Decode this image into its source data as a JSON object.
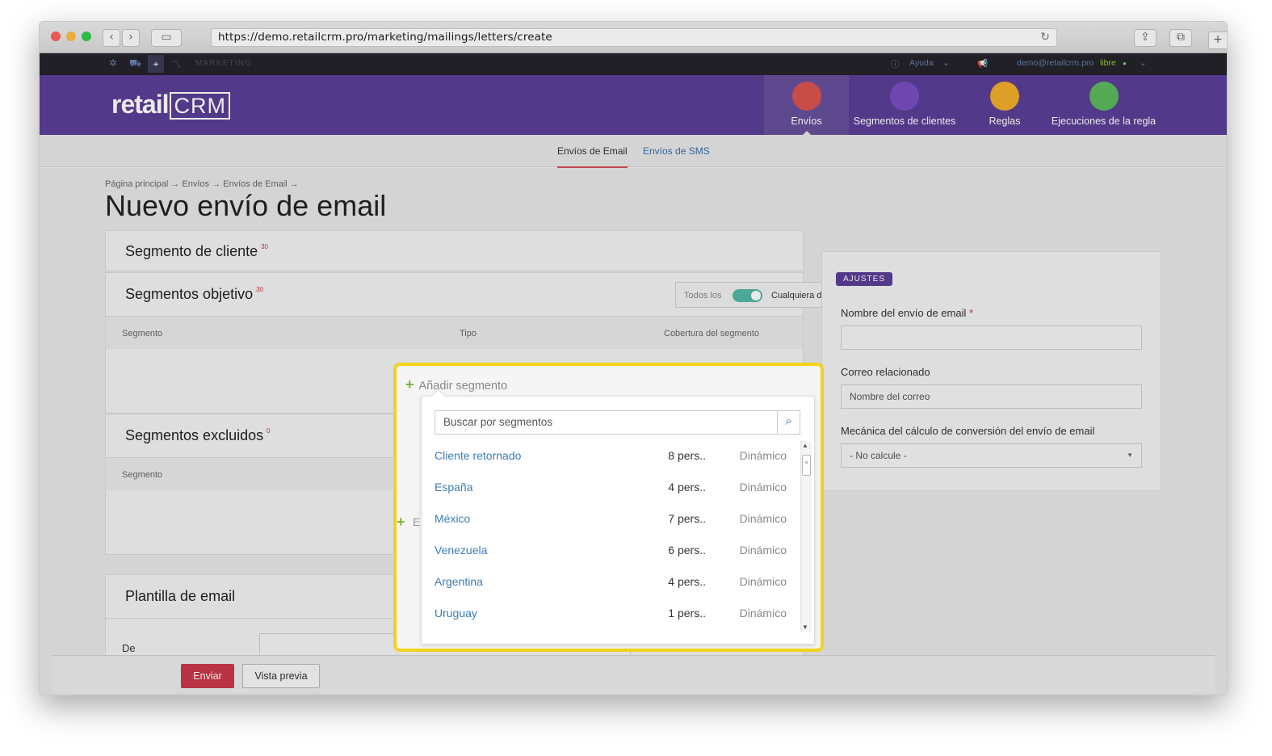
{
  "browser": {
    "url": "https://demo.retailcrm.pro/marketing/mailings/letters/create"
  },
  "topbar": {
    "section": "MARKETING",
    "help": "Ayuda",
    "user": "demo@retailcrm.pro",
    "status": "libre"
  },
  "header": {
    "logo_prefix": "retail",
    "logo_brand": "CRM",
    "nav": [
      {
        "label": "Envíos",
        "color": "#d9534f"
      },
      {
        "label": "Segmentos de clientes",
        "color": "#7a4cc0"
      },
      {
        "label": "Reglas",
        "color": "#f0ad2a"
      },
      {
        "label": "Ejecuciones de la regla",
        "color": "#5cb85c"
      }
    ]
  },
  "subtabs": {
    "email": "Envíos de Email",
    "sms": "Envíos de SMS"
  },
  "breadcrumb": "Página principal → Envíos → Envíos de Email →",
  "page_title": "Nuevo envío de email",
  "segment_card": {
    "title": "Segmento de cliente",
    "count": "30"
  },
  "target_card": {
    "title": "Segmentos objetivo",
    "count": "30",
    "toggle_left": "Todos los",
    "toggle_right": "Cualquiera de los",
    "col_segment": "Segmento",
    "col_type": "Tipo",
    "col_coverage": "Cobertura del segmento"
  },
  "excluded_card": {
    "title": "Segmentos excluidos",
    "count": "0",
    "col_segment": "Segmento",
    "add_label": "E"
  },
  "template_card": {
    "title": "Plantilla de email",
    "from_label": "De"
  },
  "settings": {
    "badge": "AJUSTES",
    "name_label": "Nombre del envío de email",
    "required_mark": "*",
    "mail_label": "Correo relacionado",
    "mail_placeholder": "Nombre del correo",
    "mechanic_label": "Mecánica del cálculo de conversión del envío de email",
    "mechanic_value": "- No calcule -"
  },
  "footer": {
    "send": "Enviar",
    "preview": "Vista previa"
  },
  "popup": {
    "add_label": "Añadir segmento",
    "search_placeholder": "Buscar por segmentos",
    "rows": [
      {
        "name": "Cliente retornado",
        "count": "8 pers..",
        "type": "Dinámico"
      },
      {
        "name": "España",
        "count": "4 pers..",
        "type": "Dinámico"
      },
      {
        "name": "México",
        "count": "7 pers..",
        "type": "Dinámico"
      },
      {
        "name": "Venezuela",
        "count": "6 pers..",
        "type": "Dinámico"
      },
      {
        "name": "Argentina",
        "count": "4 pers..",
        "type": "Dinámico"
      },
      {
        "name": "Uruguay",
        "count": "1 pers..",
        "type": "Dinámico"
      }
    ]
  },
  "colors": {
    "header": "#5b3e95",
    "highlight": "#f3d21e",
    "send_button": "#c8384a",
    "link": "#3a7db7"
  }
}
